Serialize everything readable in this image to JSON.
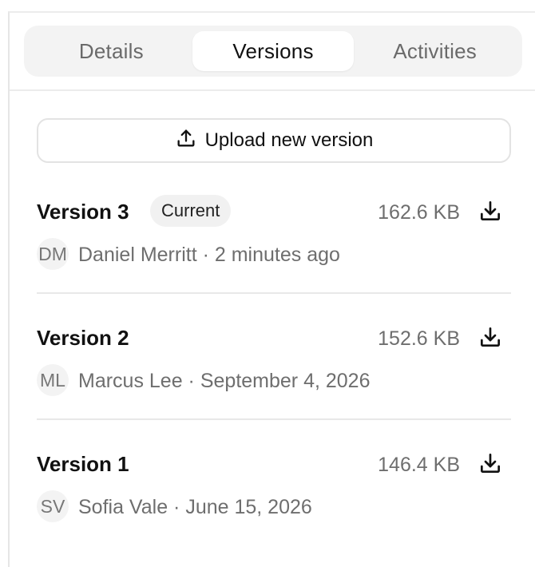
{
  "tabs": [
    {
      "label": "Details",
      "active": false
    },
    {
      "label": "Versions",
      "active": true
    },
    {
      "label": "Activities",
      "active": false
    }
  ],
  "upload": {
    "label": "Upload new version",
    "icon": "upload-icon"
  },
  "versions": [
    {
      "title": "Version 3",
      "badge": "Current",
      "size": "162.6 KB",
      "initials": "DM",
      "author": "Daniel Merritt",
      "time": "2 minutes ago",
      "meta": "Daniel Merritt · 2 minutes ago"
    },
    {
      "title": "Version 2",
      "size": "152.6 KB",
      "initials": "ML",
      "author": "Marcus Lee",
      "time": "September 4, 2026",
      "meta": "Marcus Lee · September 4, 2026"
    },
    {
      "title": "Version 1",
      "size": "146.4 KB",
      "initials": "SV",
      "author": "Sofia Vale",
      "time": "June 15, 2026",
      "meta": "Sofia Vale · June 15, 2026"
    }
  ],
  "colors": {
    "text": "#111111",
    "muted": "#6e6e6e",
    "tab_bg": "#f3f3f3",
    "border": "#e3e3e3"
  }
}
